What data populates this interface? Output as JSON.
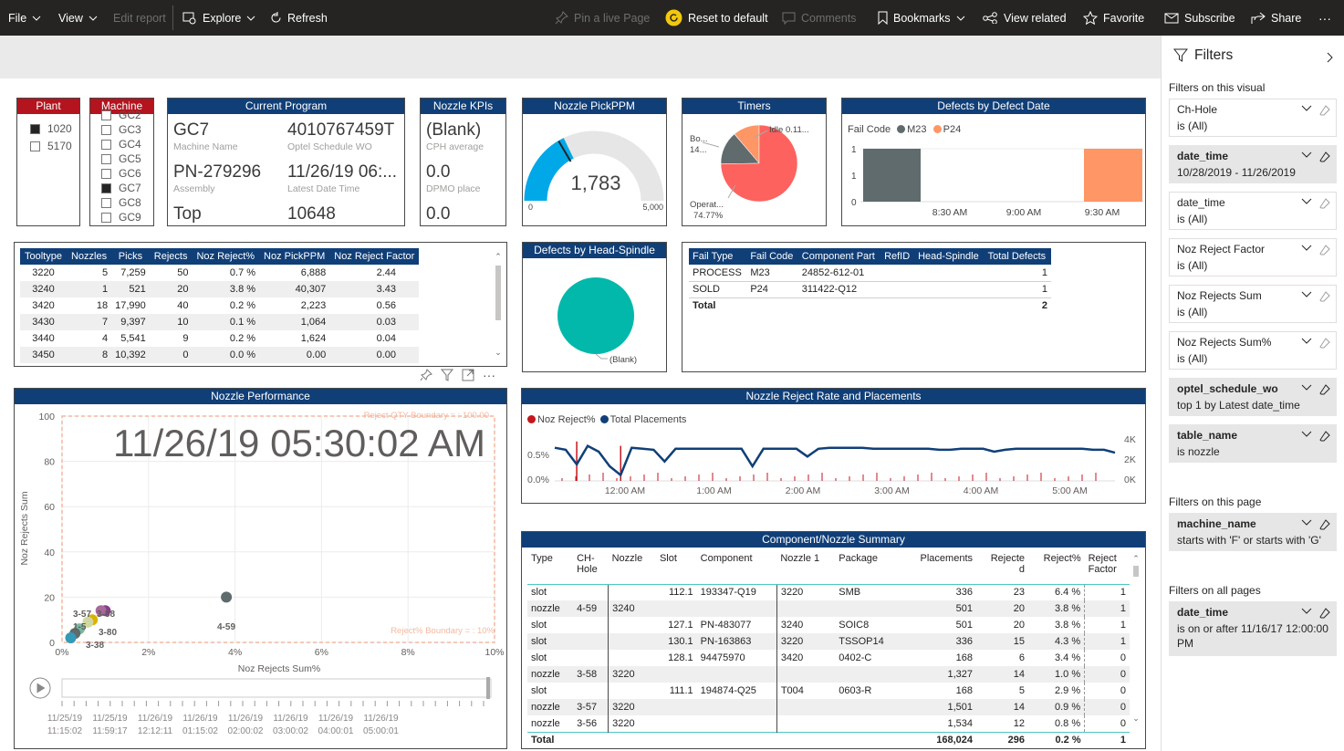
{
  "toolbar": {
    "file": "File",
    "view": "View",
    "edit": "Edit report",
    "explore": "Explore",
    "refresh": "Refresh",
    "pin": "Pin a live Page",
    "reset": "Reset to default",
    "comments": "Comments",
    "bookmarks": "Bookmarks",
    "view_related": "View related",
    "favorite": "Favorite",
    "subscribe": "Subscribe",
    "share": "Share",
    "more": "···"
  },
  "plant": {
    "title": "Plant",
    "items": [
      {
        "label": "1020",
        "checked": true
      },
      {
        "label": "5170",
        "checked": false
      }
    ]
  },
  "machine": {
    "title": "Machine",
    "items": [
      {
        "label": "GC2",
        "checked": false
      },
      {
        "label": "GC3",
        "checked": false
      },
      {
        "label": "GC4",
        "checked": false
      },
      {
        "label": "GC5",
        "checked": false
      },
      {
        "label": "GC6",
        "checked": false
      },
      {
        "label": "GC7",
        "checked": true
      },
      {
        "label": "GC8",
        "checked": false
      },
      {
        "label": "GC9",
        "checked": false
      }
    ]
  },
  "current_program": {
    "title": "Current Program",
    "machine_name": "GC7",
    "machine_name_label": "Machine Name",
    "wo": "4010767459T",
    "wo_label": "Optel Schedule WO",
    "assembly": "PN-279296",
    "assembly_label": "Assembly",
    "latest_date": "11/26/19 06:...",
    "latest_date_label": "Latest Date Time",
    "side": "Top",
    "side_count": "10648"
  },
  "nozzle_kpis": {
    "title": "Nozzle KPIs",
    "cph": "(Blank)",
    "cph_label": "CPH average",
    "dpmo": "0.0",
    "dpmo_label": "DPMO place",
    "third": "0.0"
  },
  "pickppm": {
    "title": "Nozzle PickPPM",
    "value": "1,783",
    "min": "0",
    "max": "5,000",
    "fraction": 0.357
  },
  "timers": {
    "title": "Timers",
    "idle_label": "Idle 0.11...",
    "bo_label": "Bo...",
    "bo_value": "14...",
    "op_label": "Operat...",
    "op_value": "74.77%",
    "slices": [
      {
        "name": "Operat...",
        "pct": 74.77,
        "color": "#fd625e"
      },
      {
        "name": "Bo...",
        "pct": 14.0,
        "color": "#5f6b6d"
      },
      {
        "name": "Idle",
        "pct": 11.12,
        "color": "#fe9666"
      },
      {
        "name": "x",
        "pct": 0.11,
        "color": "#01b8aa"
      }
    ]
  },
  "defects_by_date": {
    "title": "Defects by Defect Date",
    "legend_title": "Fail Code",
    "legend": [
      {
        "name": "M23",
        "color": "#5f6b6d"
      },
      {
        "name": "P24",
        "color": "#fe9666"
      }
    ],
    "y_ticks": [
      "1",
      "1",
      "0"
    ],
    "x_ticks": [
      "8:30 AM",
      "9:00 AM",
      "9:30 AM"
    ]
  },
  "tooltype_table": {
    "columns": [
      "Tooltype",
      "Nozzles",
      "Picks",
      "Rejects",
      "Noz Reject%",
      "Noz PickPPM",
      "Noz Reject Factor"
    ],
    "rows": [
      [
        "3220",
        "5",
        "7,259",
        "50",
        "0.7 %",
        "6,888",
        "2.44"
      ],
      [
        "3240",
        "1",
        "521",
        "20",
        "3.8 %",
        "40,307",
        "3.43"
      ],
      [
        "3420",
        "18",
        "17,990",
        "40",
        "0.2 %",
        "2,223",
        "0.56"
      ],
      [
        "3430",
        "7",
        "9,397",
        "10",
        "0.1 %",
        "1,064",
        "0.03"
      ],
      [
        "3440",
        "4",
        "5,541",
        "9",
        "0.2 %",
        "1,624",
        "0.04"
      ],
      [
        "3450",
        "8",
        "10,392",
        "0",
        "0.0 %",
        "0.00",
        "0.00"
      ]
    ]
  },
  "head_spindle": {
    "title": "Defects by Head-Spindle",
    "label": "(Blank)"
  },
  "fail_table": {
    "columns": [
      "Fail Type",
      "Fail Code",
      "Component Part",
      "RefID",
      "Head-Spindle",
      "Total Defects"
    ],
    "rows": [
      [
        "PROCESS",
        "M23",
        "24852-612-01",
        "",
        "",
        "1"
      ],
      [
        "SOLD",
        "P24",
        "311422-Q12",
        "",
        "",
        "1"
      ]
    ],
    "total_label": "Total",
    "total": "2"
  },
  "nozzle_perf": {
    "title": "Nozzle Performance",
    "timestamp": "11/26/19 05:30:02 AM",
    "boundary_top": "Reject QTY Boundary = : 100.00",
    "boundary_right": "Reject% Boundary = : 10%",
    "ylabel": "Noz Rejects Sum",
    "xlabel": "Noz Rejects Sum%",
    "y_ticks": [
      "100",
      "80",
      "60",
      "40",
      "20",
      "0"
    ],
    "x_ticks": [
      "0%",
      "2%",
      "4%",
      "6%",
      "8%",
      "10%"
    ],
    "point_labels": [
      "3-57",
      "3-58",
      "1-5",
      "3-80",
      "3-38",
      "4-59"
    ],
    "timeline": [
      [
        "11/25/19",
        "11:15:02"
      ],
      [
        "11/25/19",
        "11:59:17"
      ],
      [
        "11/26/19",
        "12:12:11"
      ],
      [
        "11/26/19",
        "01:15:02"
      ],
      [
        "11/26/19",
        "02:00:02"
      ],
      [
        "11/26/19",
        "03:00:02"
      ],
      [
        "11/26/19",
        "04:00:01"
      ],
      [
        "11/26/19",
        "05:00:01"
      ]
    ]
  },
  "chart_data": [
    {
      "type": "scatter",
      "title": "Nozzle Performance",
      "xlabel": "Noz Rejects Sum%",
      "ylabel": "Noz Rejects Sum",
      "xlim": [
        0,
        10
      ],
      "ylim": [
        0,
        100
      ],
      "points": [
        {
          "x": 3.8,
          "y": 20,
          "label": "4-59",
          "color": "#5f6b6d"
        },
        {
          "x": 1.0,
          "y": 14,
          "label": "3-58",
          "color": "#8b3a8b"
        },
        {
          "x": 0.9,
          "y": 14,
          "label": "3-57",
          "color": "#a66999"
        },
        {
          "x": 0.7,
          "y": 10,
          "label": "1-5",
          "color": "#d9b300"
        },
        {
          "x": 0.6,
          "y": 9,
          "label": "3-80",
          "color": "#cfd8a0"
        },
        {
          "x": 0.4,
          "y": 6,
          "label": "3-38",
          "color": "#7ab8a0"
        },
        {
          "x": 0.3,
          "y": 4,
          "label": "",
          "color": "#5f6b6d"
        },
        {
          "x": 0.2,
          "y": 2,
          "label": "",
          "color": "#3599b8"
        }
      ]
    },
    {
      "type": "line",
      "title": "Nozzle Reject Rate and Placements",
      "series": [
        {
          "name": "Noz Reject%",
          "kind": "bar",
          "color": "#c4161c",
          "values": [
            0,
            0,
            0.9,
            0,
            0,
            0,
            0.8,
            0,
            0,
            0,
            0,
            0,
            0,
            0,
            0,
            0,
            0,
            0,
            0,
            0,
            0,
            0,
            0,
            0,
            0,
            0,
            0,
            0,
            0,
            0,
            0,
            0,
            0,
            0,
            0,
            0,
            0,
            0,
            0,
            0,
            0,
            0,
            0,
            0,
            0,
            0,
            0,
            0,
            0,
            0,
            0,
            0
          ]
        },
        {
          "name": "Total Placements",
          "kind": "line",
          "color": "#103f78",
          "values": [
            3400,
            3200,
            1700,
            3600,
            3000,
            1500,
            600,
            3400,
            3300,
            3200,
            2000,
            3300,
            3300,
            3300,
            3300,
            3300,
            3300,
            3300,
            1500,
            3300,
            3300,
            3300,
            3300,
            2500,
            3300,
            3400,
            3400,
            3400,
            3400,
            3300,
            3300,
            3300,
            3300,
            3300,
            3300,
            3200,
            3200,
            3300,
            3300,
            3300,
            3000,
            3200,
            3300,
            3300,
            3300,
            3300,
            3300,
            3300,
            3300,
            3200,
            3200,
            2900
          ]
        }
      ],
      "x_ticks": [
        "12:00 AM",
        "1:00 AM",
        "2:00 AM",
        "3:00 AM",
        "4:00 AM",
        "5:00 AM"
      ],
      "y_left_ticks": [
        "0.5%",
        "0.0%"
      ],
      "y_right_ticks": [
        "4K",
        "2K",
        "0K"
      ]
    }
  ],
  "reject_rate": {
    "title": "Nozzle Reject Rate and Placements",
    "legend": [
      "Noz Reject%",
      "Total Placements"
    ],
    "x_ticks": [
      "12:00 AM",
      "1:00 AM",
      "2:00 AM",
      "3:00 AM",
      "4:00 AM",
      "5:00 AM"
    ],
    "y_left": [
      "0.5%",
      "0.0%"
    ],
    "y_right": [
      "4K",
      "2K",
      "0K"
    ]
  },
  "component_summary": {
    "title": "Component/Nozzle Summary",
    "columns": [
      "Type",
      "CH-\nHole",
      "Nozzle",
      "Slot",
      "Component",
      "Nozzle 1",
      "Package",
      "Placements",
      "Rejecte\nd",
      "Reject%",
      "Reject\nFactor"
    ],
    "rows": [
      [
        "slot",
        "",
        "",
        "112.1",
        "193347-Q19",
        "3220",
        "SMB",
        "336",
        "23",
        "6.4 %",
        "1"
      ],
      [
        "nozzle",
        "4-59",
        "3240",
        "",
        "",
        "",
        "",
        "501",
        "20",
        "3.8 %",
        "1"
      ],
      [
        "slot",
        "",
        "",
        "127.1",
        "PN-483077",
        "3240",
        "SOIC8",
        "501",
        "20",
        "3.8 %",
        "1"
      ],
      [
        "slot",
        "",
        "",
        "130.1",
        "PN-163863",
        "3220",
        "TSSOP14",
        "336",
        "15",
        "4.3 %",
        "1"
      ],
      [
        "slot",
        "",
        "",
        "128.1",
        "94475970",
        "3420",
        "0402-C",
        "168",
        "6",
        "3.4 %",
        "0"
      ],
      [
        "nozzle",
        "3-58",
        "3220",
        "",
        "",
        "",
        "",
        "1,327",
        "14",
        "1.0 %",
        "0"
      ],
      [
        "slot",
        "",
        "",
        "111.1",
        "194874-Q25",
        "T004",
        "0603-R",
        "168",
        "5",
        "2.9 %",
        "0"
      ],
      [
        "nozzle",
        "3-57",
        "3220",
        "",
        "",
        "",
        "",
        "1,501",
        "14",
        "0.9 %",
        "0"
      ],
      [
        "nozzle",
        "3-56",
        "3220",
        "",
        "",
        "",
        "",
        "1,534",
        "12",
        "0.8 %",
        "0"
      ]
    ],
    "total": [
      "Total",
      "",
      "",
      "",
      "",
      "",
      "",
      "168,024",
      "296",
      "0.2 %",
      "1"
    ]
  },
  "filters": {
    "title": "Filters",
    "on_visual": "Filters on this visual",
    "visual_cards": [
      {
        "title": "Ch-Hole",
        "sub": "is (All)",
        "active": false
      },
      {
        "title": "date_time",
        "sub": "10/28/2019 - 11/26/2019",
        "active": true
      },
      {
        "title": "date_time",
        "sub": "is (All)",
        "active": false
      },
      {
        "title": "Noz Reject Factor",
        "sub": "is (All)",
        "active": false
      },
      {
        "title": "Noz Rejects Sum",
        "sub": "is (All)",
        "active": false
      },
      {
        "title": "Noz Rejects Sum%",
        "sub": "is (All)",
        "active": false
      },
      {
        "title": "optel_schedule_wo",
        "sub": "top 1 by Latest date_time",
        "active": true
      },
      {
        "title": "table_name",
        "sub": "is nozzle",
        "active": true
      }
    ],
    "on_page": "Filters on this page",
    "page_card": {
      "title": "machine_name",
      "sub": "starts with 'F' or starts with 'G'"
    },
    "on_all": "Filters on all pages",
    "all_card": {
      "title": "date_time",
      "sub": "is on or after 11/16/17 12:00:00",
      "sub2": "PM"
    }
  }
}
